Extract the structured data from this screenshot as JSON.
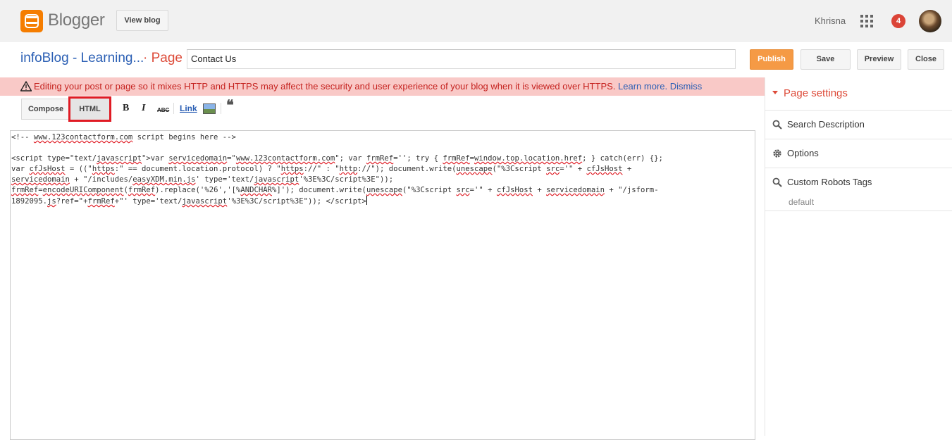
{
  "header": {
    "logo_text": "Blogger",
    "view_blog_label": "View blog",
    "user_name": "Khrisna",
    "notification_count": "4"
  },
  "title_row": {
    "blog_name": "infoBlog - Learning...",
    "separator": "·",
    "page_label": "Page",
    "page_title_value": "Contact Us",
    "publish_label": "Publish",
    "save_label": "Save",
    "preview_label": "Preview",
    "close_label": "Close"
  },
  "warning": {
    "text": "Editing your post or page so it mixes HTTP and HTTPS may affect the security and user experience of your blog when it is viewed over HTTPS.",
    "learn_more": "Learn more.",
    "dismiss": "Dismiss"
  },
  "toolbar": {
    "compose_label": "Compose",
    "html_label": "HTML",
    "bold_glyph": "B",
    "italic_glyph": "I",
    "strike_glyph": "ABC",
    "link_label": "Link",
    "quote_glyph": "❝"
  },
  "editor": {
    "line_comment": "<!-- www.123contactform.com script begins here -->"
  },
  "right_panel": {
    "heading": "Page settings",
    "search_description": "Search Description",
    "options": "Options",
    "custom_robots_tags": "Custom Robots Tags",
    "robots_value": "default"
  },
  "colors": {
    "brand_orange": "#f57d00",
    "publish_bg": "#f59a45",
    "link_blue": "#2b5fb4",
    "warning_bg": "#f9c9c7",
    "warning_text": "#c5221f",
    "highlight_red": "#e01b24"
  }
}
